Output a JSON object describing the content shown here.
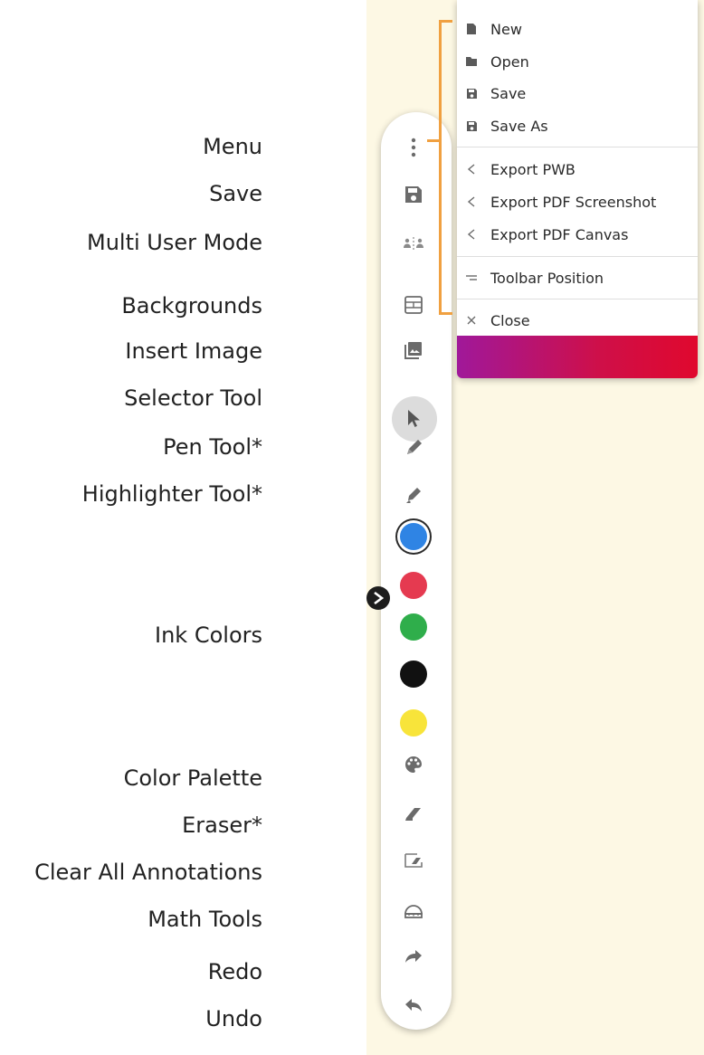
{
  "labels": {
    "menu": "Menu",
    "save": "Save",
    "multi_user": "Multi User Mode",
    "backgrounds": "Backgrounds",
    "insert_image": "Insert Image",
    "selector": "Selector Tool",
    "pen": "Pen Tool*",
    "highlighter": "Highlighter Tool*",
    "ink_colors": "Ink Colors",
    "palette": "Color Palette",
    "eraser": "Eraser*",
    "clear_all": "Clear All Annotations",
    "math_tools": "Math Tools",
    "redo": "Redo",
    "undo": "Undo"
  },
  "menu": {
    "items": [
      {
        "label": "New",
        "icon": "file-icon"
      },
      {
        "label": "Open",
        "icon": "folder-icon"
      },
      {
        "label": "Save",
        "icon": "floppy-icon"
      },
      {
        "label": "Save As",
        "icon": "floppy-icon"
      },
      {
        "label": "Export PWB",
        "icon": "share-icon"
      },
      {
        "label": "Export PDF Screenshot",
        "icon": "share-icon"
      },
      {
        "label": "Export PDF Canvas",
        "icon": "share-icon"
      },
      {
        "label": "Toolbar Position",
        "icon": "toolbar-position-icon"
      },
      {
        "label": "Close",
        "icon": "close-icon"
      }
    ]
  },
  "ink_colors": [
    {
      "name": "blue",
      "hex": "#2f84e4",
      "selected": true
    },
    {
      "name": "red",
      "hex": "#e53a50"
    },
    {
      "name": "green",
      "hex": "#2fae4b"
    },
    {
      "name": "black",
      "hex": "#111111"
    },
    {
      "name": "yellow",
      "hex": "#f8e43a"
    }
  ],
  "colors": {
    "canvas_bg": "#fdf8e4",
    "bracket": "#f0a040",
    "icon": "#6b6b6b",
    "menu_footer_start": "#a0189a",
    "menu_footer_end": "#e0082e"
  }
}
